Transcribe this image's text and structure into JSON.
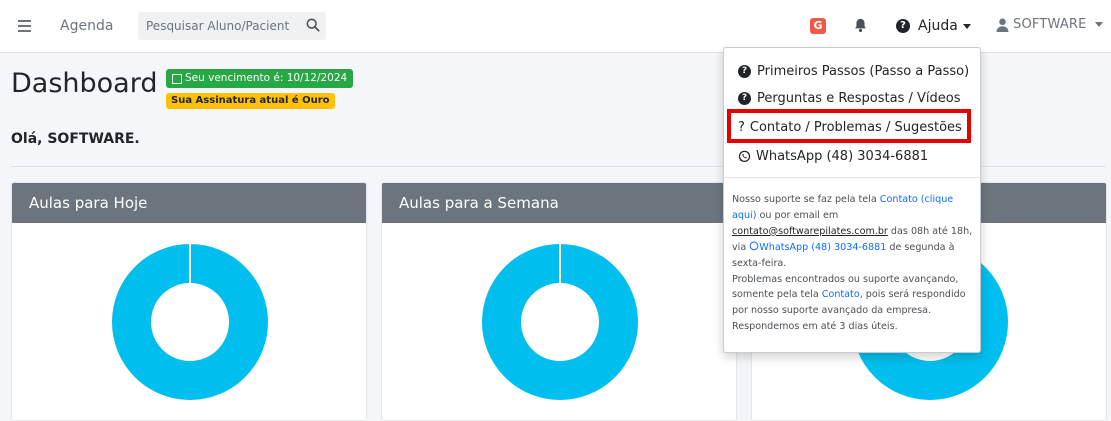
{
  "nav": {
    "agenda": "Agenda",
    "search_placeholder": "Pesquisar Aluno/Pacient",
    "g_badge": "G",
    "help_label": "Ajuda",
    "user_label": "SOFTWARE"
  },
  "header": {
    "title": "Dashboard",
    "badge_due": "Seu vencimento é: 10/12/2024",
    "badge_plan": "Sua Assinatura atual é Ouro",
    "greeting": "Olá, SOFTWARE."
  },
  "cards": [
    {
      "title": "Aulas para Hoje"
    },
    {
      "title": "Aulas para a Semana"
    },
    {
      "title": ""
    }
  ],
  "dropdown": {
    "items": [
      "Primeiros Passos (Passo a Passo)",
      "Perguntas e Respostas / Vídeos",
      "Contato / Problemas / Sugestões",
      "WhatsApp (48) 3034-6881"
    ],
    "info": {
      "l1a": "Nosso suporte se faz pela tela ",
      "l1b": "Contato (clique aqui)",
      "l1c": " ou por email em ",
      "email": "contato@softwarepilates.com.br",
      "l2a": " das 08h até 18h, via ",
      "wa": "WhatsApp (48) 3034-6881",
      "l2b": " de segunda à sexta-feira.",
      "l3a": "Problemas encontrados ou suporte avançando, somente pela tela ",
      "l3b": "Contato",
      "l3c": ", pois será respondido por nosso suporte avançado da empresa.",
      "l4": "Respondemos em até 3 dias úteis."
    }
  },
  "colors": {
    "donut": "#00bfee",
    "card_header": "#6c757d",
    "badge_green": "#28a745",
    "badge_yellow": "#ffc107",
    "highlight": "#e60000"
  }
}
